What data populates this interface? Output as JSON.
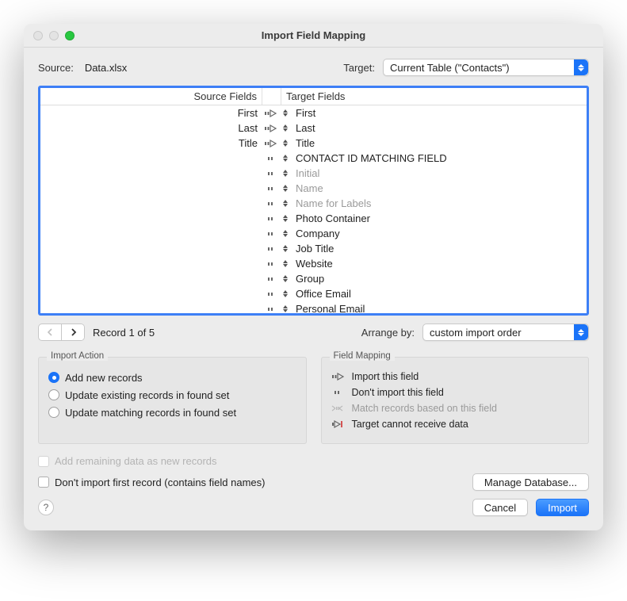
{
  "window_title": "Import Field Mapping",
  "source_label": "Source:",
  "source_value": "Data.xlsx",
  "target_label": "Target:",
  "target_value": "Current Table (\"Contacts\")",
  "columns": {
    "source": "Source Fields",
    "target": "Target Fields"
  },
  "rows": [
    {
      "src": "First",
      "arrow": "import",
      "tgt": "First",
      "grey": false
    },
    {
      "src": "Last",
      "arrow": "import",
      "tgt": "Last",
      "grey": false
    },
    {
      "src": "Title",
      "arrow": "import",
      "tgt": "Title",
      "grey": false
    },
    {
      "src": "",
      "arrow": "skip",
      "tgt": "CONTACT ID MATCHING FIELD",
      "grey": false
    },
    {
      "src": "",
      "arrow": "skip",
      "tgt": "Initial",
      "grey": true
    },
    {
      "src": "",
      "arrow": "skip",
      "tgt": "Name",
      "grey": true
    },
    {
      "src": "",
      "arrow": "skip",
      "tgt": "Name for Labels",
      "grey": true
    },
    {
      "src": "",
      "arrow": "skip",
      "tgt": "Photo Container",
      "grey": false
    },
    {
      "src": "",
      "arrow": "skip",
      "tgt": "Company",
      "grey": false
    },
    {
      "src": "",
      "arrow": "skip",
      "tgt": "Job Title",
      "grey": false
    },
    {
      "src": "",
      "arrow": "skip",
      "tgt": "Website",
      "grey": false
    },
    {
      "src": "",
      "arrow": "skip",
      "tgt": "Group",
      "grey": false
    },
    {
      "src": "",
      "arrow": "skip",
      "tgt": "Office Email",
      "grey": false
    },
    {
      "src": "",
      "arrow": "skip",
      "tgt": "Personal Email",
      "grey": false
    }
  ],
  "record_label": "Record 1 of 5",
  "arrange_label": "Arrange by:",
  "arrange_value": "custom import order",
  "import_action": {
    "title": "Import Action",
    "opt1": "Add new records",
    "opt2": "Update existing records in found set",
    "opt3": "Update matching records in found set"
  },
  "field_mapping": {
    "title": "Field Mapping",
    "l1": "Import this field",
    "l2": "Don't import this field",
    "l3": "Match records based on this field",
    "l4": "Target cannot receive data"
  },
  "add_remaining": "Add remaining data as new records",
  "dont_import_first": "Don't import first record (contains field names)",
  "manage_db": "Manage Database...",
  "cancel": "Cancel",
  "import": "Import"
}
